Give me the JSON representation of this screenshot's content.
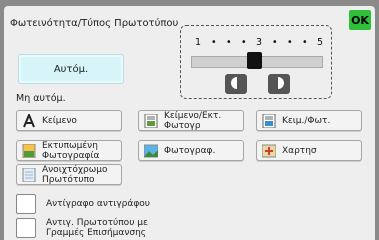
{
  "header": {
    "title": "Φωτεινότητα/Τύπος Πρωτοτύπου",
    "ok_label": "OK"
  },
  "density": {
    "scale": [
      "1",
      "•",
      "•",
      "•",
      "3",
      "•",
      "•",
      "•",
      "5"
    ],
    "level": 3
  },
  "auto_button": "Αυτόμ.",
  "manual_label": "Μη αυτόμ.",
  "options": {
    "text": "Κείμενο",
    "text_print_photo": "Κείμενο/Εκτ. Φωτογρ",
    "text_photo": "Κειμ./Φωτ.",
    "printed_photo": "Εκτυπωμένη Φωτογραφία",
    "photo": "Φωτογραφ.",
    "map": "Χαρτησ",
    "light_original": "Ανοιχτόχρωμο Πρωτότυπο"
  },
  "checkboxes": {
    "copy_of_copy": "Αντίγραφο αντιγράφου",
    "highlighter": "Αντιγ. Πρωτοτύπου με Γραμμές Επισήμανσης"
  },
  "colors": {
    "ok": "#2fbf3a",
    "auto_bg": "#d7f5f8"
  }
}
